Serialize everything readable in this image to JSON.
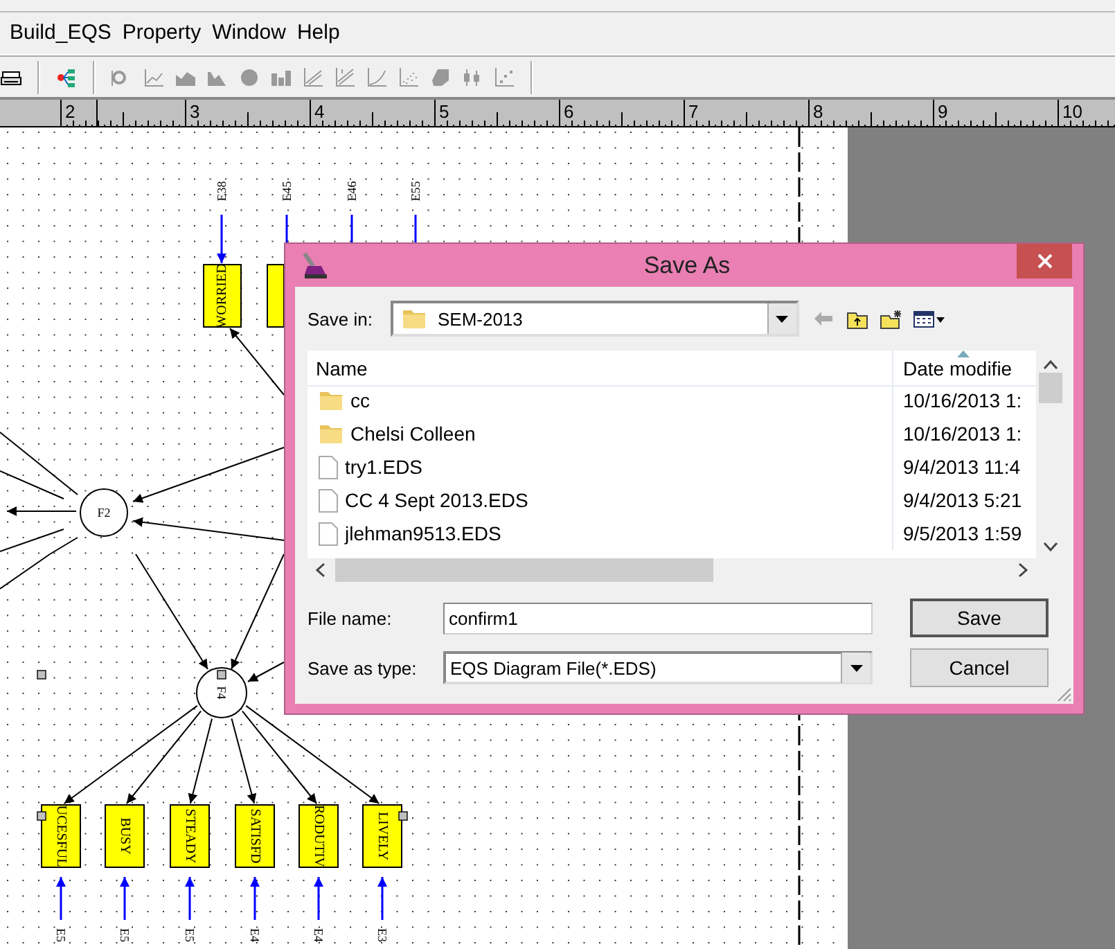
{
  "menu": [
    {
      "label": "Build_EQS"
    },
    {
      "label": "Property"
    },
    {
      "label": "Window"
    },
    {
      "label": "Help"
    }
  ],
  "ruler": {
    "labels": [
      "2",
      "3",
      "4",
      "5",
      "6",
      "7",
      "8",
      "9",
      "10"
    ]
  },
  "diagram": {
    "factors": [
      {
        "label": "F2"
      },
      {
        "label": "F4"
      }
    ],
    "top_errors": [
      "E38",
      "E45",
      "E46",
      "E55"
    ],
    "top_indicators": [
      {
        "label": "WORRIED"
      }
    ],
    "bottom_indicators": [
      {
        "label": "UCESFUL",
        "error": "E5"
      },
      {
        "label": "BUSY",
        "error": "E5"
      },
      {
        "label": "STEADY",
        "error": "E5"
      },
      {
        "label": "SATISFD",
        "error": "E4"
      },
      {
        "label": "RODUTIV",
        "error": "E4"
      },
      {
        "label": "LIVELY",
        "error": "E3"
      }
    ]
  },
  "dialog": {
    "title": "Save As",
    "save_in_label": "Save in:",
    "save_in": "SEM-2013",
    "columns": [
      {
        "label": "Name",
        "sorted": false
      },
      {
        "label": "Date modifie",
        "sorted": true
      }
    ],
    "files": [
      {
        "kind": "folder",
        "name": "cc",
        "date": "10/16/2013 1:"
      },
      {
        "kind": "folder",
        "name": "Chelsi Colleen",
        "date": "10/16/2013 1:"
      },
      {
        "kind": "file",
        "name": "try1.EDS",
        "date": "9/4/2013 11:4"
      },
      {
        "kind": "file",
        "name": "CC 4 Sept 2013.EDS",
        "date": "9/4/2013 5:21"
      },
      {
        "kind": "file",
        "name": "jlehman9513.EDS",
        "date": "9/5/2013 1:59"
      }
    ],
    "file_name_label": "File name:",
    "file_name": "confirm1",
    "type_label": "Save as type:",
    "type": "EQS Diagram File(*.EDS)",
    "buttons": [
      {
        "label": "Save",
        "default": true
      },
      {
        "label": "Cancel",
        "default": false
      }
    ]
  }
}
